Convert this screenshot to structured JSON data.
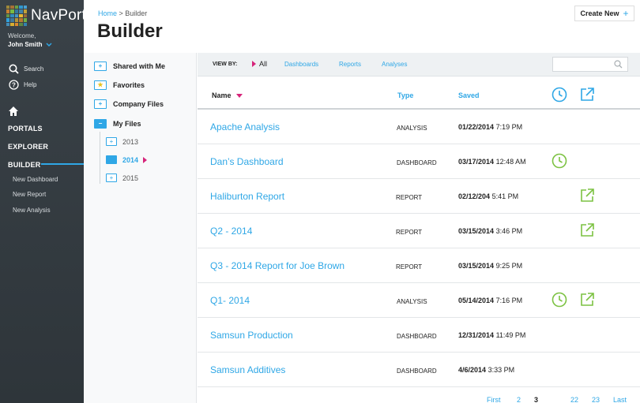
{
  "app": {
    "name": "NavPort"
  },
  "user": {
    "welcome": "Welcome,",
    "name": "John Smith"
  },
  "sidebar": {
    "search": "Search",
    "help": "Help",
    "sections": {
      "portals": "PORTALS",
      "explorer": "EXPLORER",
      "builder": "BUILDER"
    },
    "builder_items": [
      "New Dashboard",
      "New Report",
      "New Analysis"
    ]
  },
  "header": {
    "breadcrumb_home": "Home",
    "breadcrumb_sep": " > ",
    "breadcrumb_current": "Builder",
    "title": "Builder",
    "create_new": "Create New"
  },
  "tree": {
    "shared": "Shared with Me",
    "favorites": "Favorites",
    "company": "Company Files",
    "my_files": "My Files",
    "years": [
      "2013",
      "2014",
      "2015"
    ]
  },
  "filter": {
    "view_by": "VIEW BY:",
    "all": "All",
    "dashboards": "Dashboards",
    "reports": "Reports",
    "analyses": "Analyses",
    "search_placeholder": ""
  },
  "table": {
    "columns": {
      "name": "Name",
      "type": "Type",
      "saved": "Saved"
    },
    "rows": [
      {
        "name": "Apache Analysis",
        "type": "ANALYSIS",
        "date": "01/22/2014",
        "time": "7:19 PM",
        "clock": false,
        "external": false
      },
      {
        "name": "Dan’s Dashboard",
        "type": "DASHBOARD",
        "date": "03/17/2014",
        "time": "12:48 AM",
        "clock": true,
        "external": false
      },
      {
        "name": "Haliburton Report",
        "type": "REPORT",
        "date": "02/12/204",
        "time": "5:41 PM",
        "clock": false,
        "external": true
      },
      {
        "name": "Q2 - 2014",
        "type": "REPORT",
        "date": "03/15/2014",
        "time": "3:46 PM",
        "clock": false,
        "external": true
      },
      {
        "name": "Q3 - 2014 Report for Joe Brown",
        "type": "REPORT",
        "date": "03/15/2014",
        "time": "9:25 PM",
        "clock": false,
        "external": false
      },
      {
        "name": "Q1- 2014",
        "type": "ANALYSIS",
        "date": "05/14/2014",
        "time": "7:16 PM",
        "clock": true,
        "external": true
      },
      {
        "name": "Samsun Production",
        "type": "DASHBOARD",
        "date": "12/31/2014",
        "time": "11:49 PM",
        "clock": false,
        "external": false
      },
      {
        "name": "Samsun Additives",
        "type": "DASHBOARD",
        "date": "4/6/2014",
        "time": "3:33 PM",
        "clock": false,
        "external": false
      }
    ]
  },
  "pagination": {
    "first": "First",
    "p2": "2",
    "p3": "3",
    "p22": "22",
    "p23": "23",
    "last": "Last"
  },
  "colors": {
    "accent": "#2fa7e6",
    "green": "#7cc242",
    "pink": "#d6247a",
    "sidebar": "#343c41"
  }
}
